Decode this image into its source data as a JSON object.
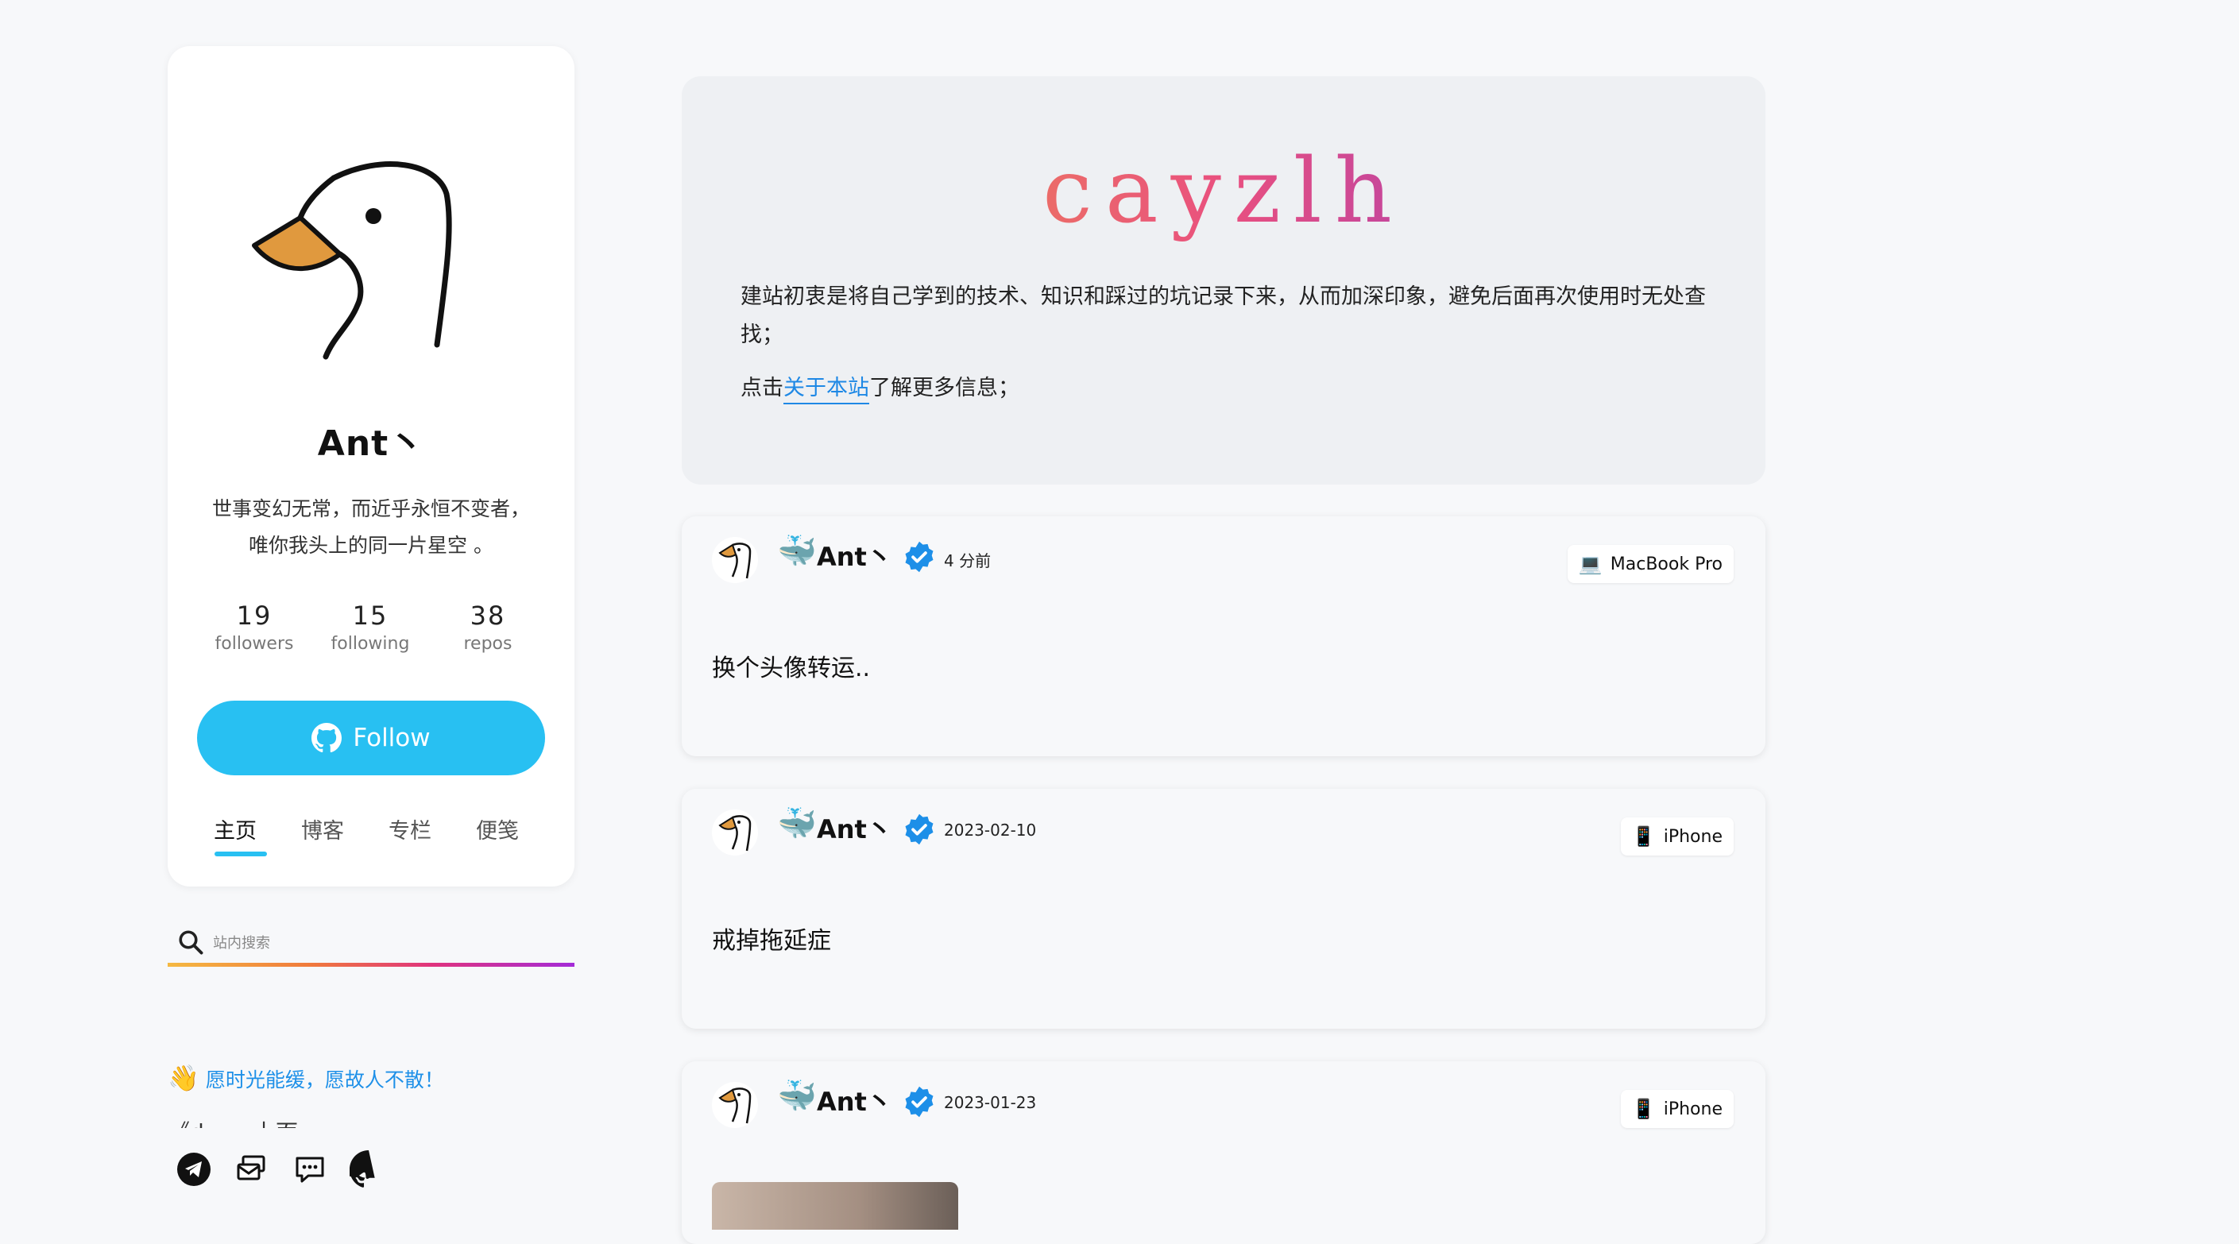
{
  "profile": {
    "name": "Ant丶",
    "bio_line1": "世事变幻无常，而近乎永恒不变者，",
    "bio_line2": "唯你我头上的同一片星空 。",
    "stats": [
      {
        "num": "19",
        "label": "followers"
      },
      {
        "num": "15",
        "label": "following"
      },
      {
        "num": "38",
        "label": "repos"
      }
    ],
    "follow_label": "Follow",
    "tabs": [
      "主页",
      "博客",
      "专栏",
      "便笺"
    ],
    "active_tab": "主页"
  },
  "search": {
    "placeholder": "站内搜索"
  },
  "quote": {
    "emoji": "👋",
    "text": "愿时光能缓，愿故人不散！"
  },
  "marquee": {
    "text": "《du ... 上面"
  },
  "social": [
    "telegram-icon",
    "email-icon",
    "message-icon",
    "github-icon"
  ],
  "hero": {
    "title": "cayzlh",
    "paragraph": "建站初衷是将自己学到的技术、知识和踩过的坑记录下来，从而加深印象，避免后面再次使用时无处查找；",
    "link_prefix": "点击",
    "link_text": "关于本站",
    "link_suffix": "了解更多信息；"
  },
  "colors": {
    "accent": "#28c0f2",
    "link": "#1e88e5",
    "verified": "#1d8fe8",
    "gradient": [
      "#f0a33a",
      "#e9507f",
      "#7b32d6"
    ]
  },
  "posts": [
    {
      "user": "Ant丶",
      "whale": "🐳",
      "time": "4 分前",
      "device": "MacBook Pro",
      "device_icon": "💻",
      "content": "换个头像转运.."
    },
    {
      "user": "Ant丶",
      "whale": "🐳",
      "time": "2023-02-10",
      "device": "iPhone",
      "device_icon": "📱",
      "content": "戒掉拖延症"
    },
    {
      "user": "Ant丶",
      "whale": "🐳",
      "time": "2023-01-23",
      "device": "iPhone",
      "device_icon": "📱",
      "content": ""
    }
  ]
}
